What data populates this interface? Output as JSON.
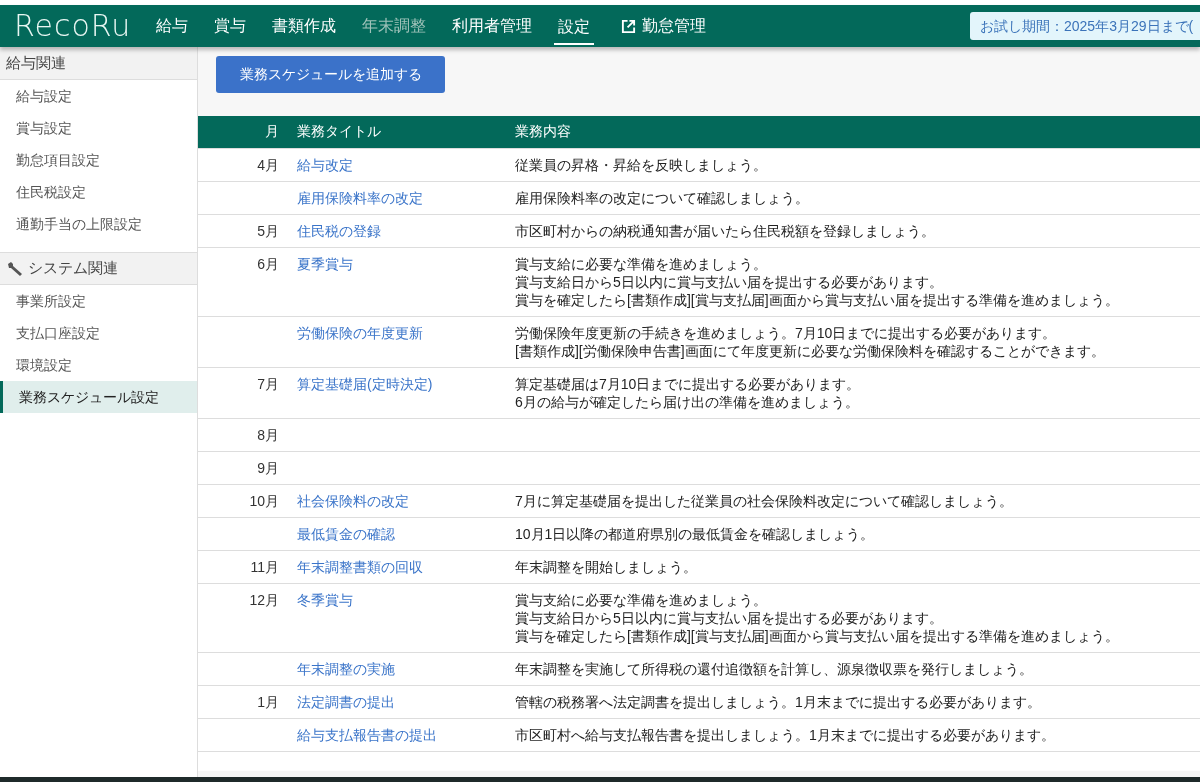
{
  "header": {
    "logo": "RecoRu",
    "nav": [
      {
        "label": "給与",
        "selected": false,
        "disabled": false
      },
      {
        "label": "賞与",
        "selected": false,
        "disabled": false
      },
      {
        "label": "書類作成",
        "selected": false,
        "disabled": false
      },
      {
        "label": "年末調整",
        "selected": false,
        "disabled": true
      },
      {
        "label": "利用者管理",
        "selected": false,
        "disabled": false
      },
      {
        "label": "設定",
        "selected": true,
        "disabled": false
      }
    ],
    "external_link": "勤怠管理",
    "trial_badge": "お試し期間：2025年3月29日まで("
  },
  "sidebar": {
    "groups": [
      {
        "title": "給与関連",
        "items": [
          {
            "label": "給与設定",
            "selected": false
          },
          {
            "label": "賞与設定",
            "selected": false
          },
          {
            "label": "勤怠項目設定",
            "selected": false
          },
          {
            "label": "住民税設定",
            "selected": false
          },
          {
            "label": "通勤手当の上限設定",
            "selected": false
          }
        ]
      },
      {
        "title": "システム関連",
        "items": [
          {
            "label": "事業所設定",
            "selected": false
          },
          {
            "label": "支払口座設定",
            "selected": false
          },
          {
            "label": "環境設定",
            "selected": false
          },
          {
            "label": "業務スケジュール設定",
            "selected": true
          }
        ]
      }
    ]
  },
  "add_button": "業務スケジュールを追加する",
  "table": {
    "columns": [
      "月",
      "業務タイトル",
      "業務内容"
    ],
    "rows": [
      {
        "month": "4月",
        "title": "給与改定",
        "content": [
          "従業員の昇格・昇給を反映しましょう。"
        ]
      },
      {
        "title": "雇用保険料率の改定",
        "content": [
          "雇用保険料率の改定について確認しましょう。"
        ]
      },
      {
        "month": "5月",
        "title": "住民税の登録",
        "content": [
          "市区町村からの納税通知書が届いたら住民税額を登録しましょう。"
        ]
      },
      {
        "month": "6月",
        "title": "夏季賞与",
        "content": [
          "賞与支給に必要な準備を進めましょう。",
          "賞与支給日から5日以内に賞与支払い届を提出する必要があります。",
          "賞与を確定したら[書類作成][賞与支払届]画面から賞与支払い届を提出する準備を進めましょう。"
        ]
      },
      {
        "title": "労働保険の年度更新",
        "content": [
          "労働保険年度更新の手続きを進めましょう。7月10日までに提出する必要があります。",
          "[書類作成][労働保険申告書]画面にて年度更新に必要な労働保険料を確認することができます。"
        ]
      },
      {
        "month": "7月",
        "title": "算定基礎届(定時決定)",
        "content": [
          "算定基礎届は7月10日までに提出する必要があります。",
          "6月の給与が確定したら届け出の準備を進めましょう。"
        ]
      },
      {
        "month": "8月"
      },
      {
        "month": "9月"
      },
      {
        "month": "10月",
        "title": "社会保険料の改定",
        "content": [
          "7月に算定基礎届を提出した従業員の社会保険料改定について確認しましょう。"
        ]
      },
      {
        "title": "最低賃金の確認",
        "content": [
          "10月1日以降の都道府県別の最低賃金を確認しましょう。"
        ]
      },
      {
        "month": "11月",
        "title": "年末調整書類の回収",
        "content": [
          "年末調整を開始しましょう。"
        ]
      },
      {
        "month": "12月",
        "title": "冬季賞与",
        "content": [
          "賞与支給に必要な準備を進めましょう。",
          "賞与支給日から5日以内に賞与支払い届を提出する必要があります。",
          "賞与を確定したら[書類作成][賞与支払届]画面から賞与支払い届を提出する準備を進めましょう。"
        ]
      },
      {
        "title": "年末調整の実施",
        "content": [
          "年末調整を実施して所得税の還付追徴額を計算し、源泉徴収票を発行しましょう。"
        ]
      },
      {
        "month": "1月",
        "title": "法定調書の提出",
        "content": [
          "管轄の税務署へ法定調書を提出しましょう。1月末までに提出する必要があります。"
        ]
      },
      {
        "title": "給与支払報告書の提出",
        "content": [
          "市区町村へ給与支払報告書を提出しましょう。1月末までに提出する必要があります。"
        ]
      }
    ]
  }
}
